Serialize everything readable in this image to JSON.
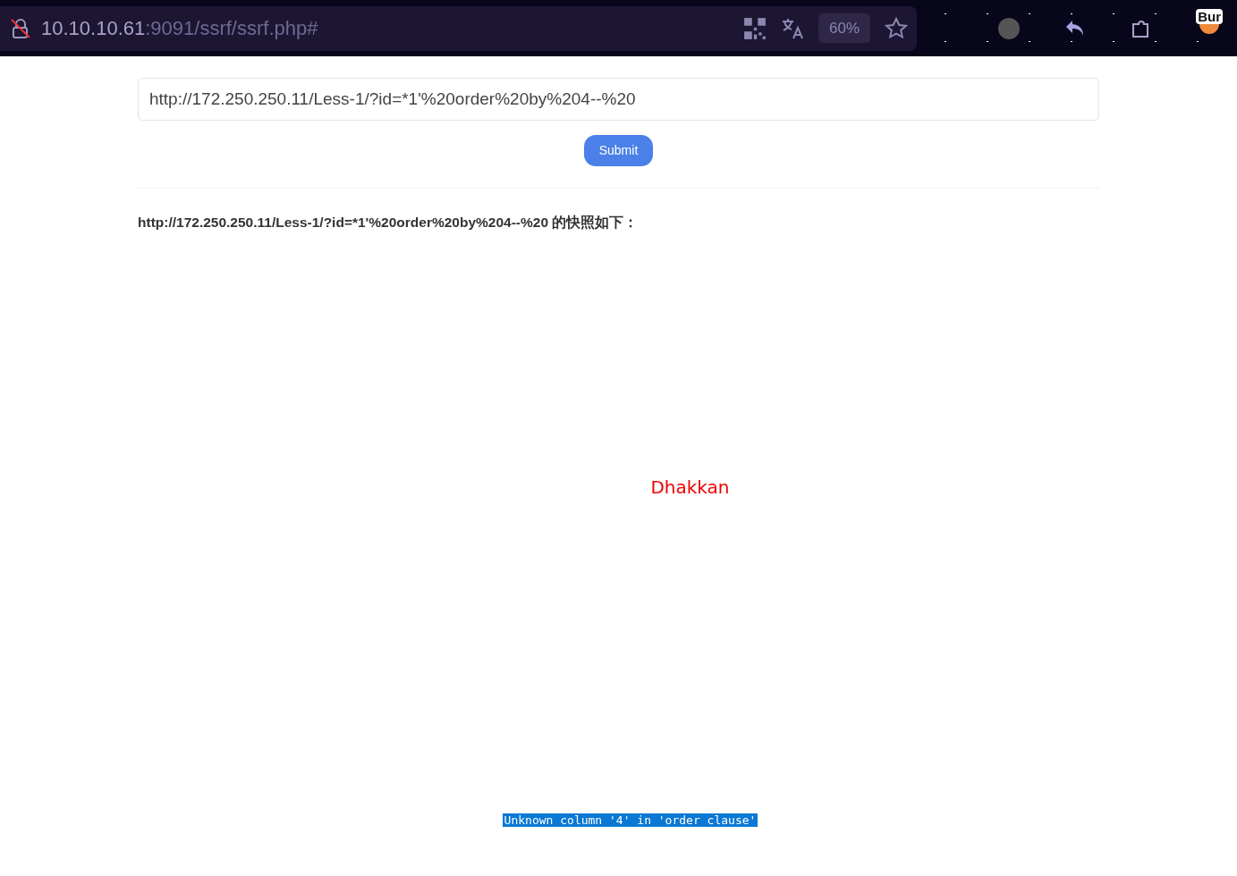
{
  "browser": {
    "address_host": "10.10.10.61",
    "address_path": ":9091/ssrf/ssrf.php#",
    "zoom": "60%",
    "extension_badge": "Bur"
  },
  "form": {
    "url_value": "http://172.250.250.11/Less-1/?id=*1'%20order%20by%204--%20",
    "submit": "Submit"
  },
  "result": {
    "heading": "http://172.250.250.11/Less-1/?id=*1'%20order%20by%204--%20 的快照如下：",
    "title": "Dhakkan",
    "error": {
      "text": "Unknown column '4' in 'order clause'",
      "selected": true
    }
  }
}
